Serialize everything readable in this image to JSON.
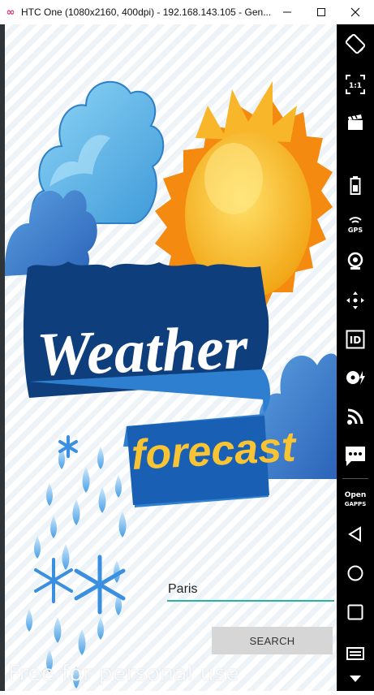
{
  "window": {
    "title": "HTC One (1080x2160, 400dpi) - 192.168.143.105 - Gen...",
    "controls": {
      "minimize": "—",
      "maximize": "☐",
      "close": "✕"
    }
  },
  "app": {
    "logo": {
      "word1": "Weather",
      "word2": "forecast"
    },
    "city_input": {
      "value": "Paris"
    },
    "search_button": {
      "label": "SEARCH"
    },
    "watermark": "Free for personal use"
  },
  "sidebar": {
    "items": [
      {
        "icon": "rotate-icon"
      },
      {
        "icon": "pixel-perfect-icon",
        "label": "1:1"
      },
      {
        "icon": "screen-record-icon"
      },
      {
        "icon": "battery-icon"
      },
      {
        "icon": "gps-icon",
        "label": "GPS"
      },
      {
        "icon": "webcam-icon"
      },
      {
        "icon": "move-icon"
      },
      {
        "icon": "identifiers-icon",
        "label": "ID"
      },
      {
        "icon": "disk-io-icon"
      },
      {
        "icon": "cast-icon"
      },
      {
        "icon": "sms-icon"
      },
      {
        "icon": "open-gapps-icon",
        "label_line1": "Open",
        "label_line2": "GAPPS"
      },
      {
        "icon": "back-icon"
      },
      {
        "icon": "home-icon"
      },
      {
        "icon": "recent-apps-icon"
      },
      {
        "icon": "menu-icon"
      },
      {
        "icon": "expand-down-icon"
      }
    ]
  },
  "colors": {
    "sidebar_bg": "#000000",
    "input_underline": "#26b5a0",
    "button_bg": "#d6d6d6",
    "logo_banner": "#0d4a8a",
    "sun": "#f7b71e",
    "cloud": "#6cc3ef"
  }
}
